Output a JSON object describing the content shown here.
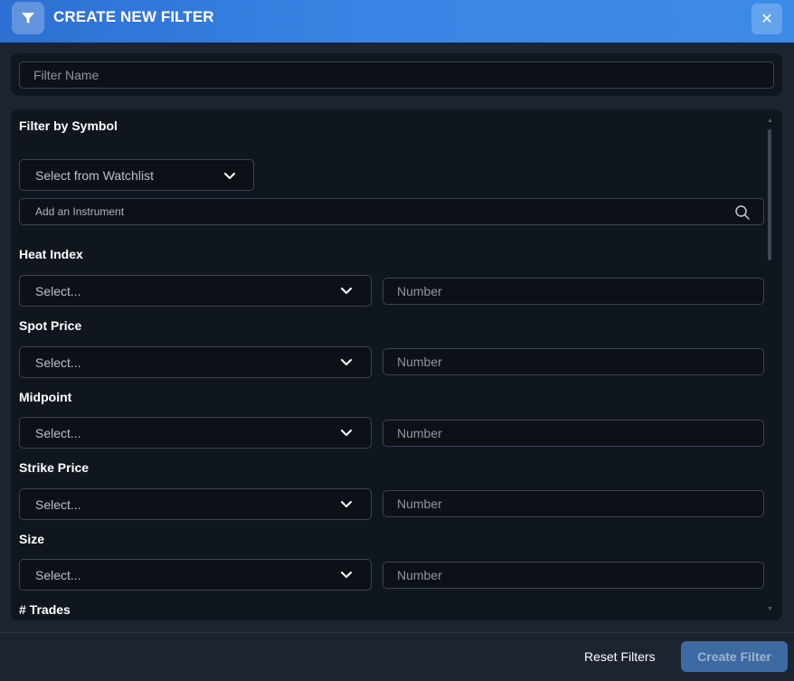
{
  "header": {
    "title": "CREATE NEW FILTER",
    "icon": "filter-icon",
    "close_icon": "close-icon",
    "close_glyph": "✕"
  },
  "filter_name": {
    "placeholder": "Filter Name",
    "value": ""
  },
  "symbol_section": {
    "label": "Filter by Symbol",
    "watchlist_placeholder": "Select from Watchlist",
    "instrument_placeholder": "Add an Instrument"
  },
  "fields": [
    {
      "label": "Heat Index",
      "select_placeholder": "Select...",
      "number_placeholder": "Number"
    },
    {
      "label": "Spot Price",
      "select_placeholder": "Select...",
      "number_placeholder": "Number"
    },
    {
      "label": "Midpoint",
      "select_placeholder": "Select...",
      "number_placeholder": "Number"
    },
    {
      "label": "Strike Price",
      "select_placeholder": "Select...",
      "number_placeholder": "Number"
    },
    {
      "label": "Size",
      "select_placeholder": "Select...",
      "number_placeholder": "Number"
    },
    {
      "label": "# Trades"
    }
  ],
  "footer": {
    "reset_label": "Reset Filters",
    "create_label": "Create Filter"
  },
  "colors": {
    "header_accent": "#3a86e6",
    "background": "#1b2430",
    "card": "#0f161e",
    "create_button": "#3d6aa3"
  }
}
